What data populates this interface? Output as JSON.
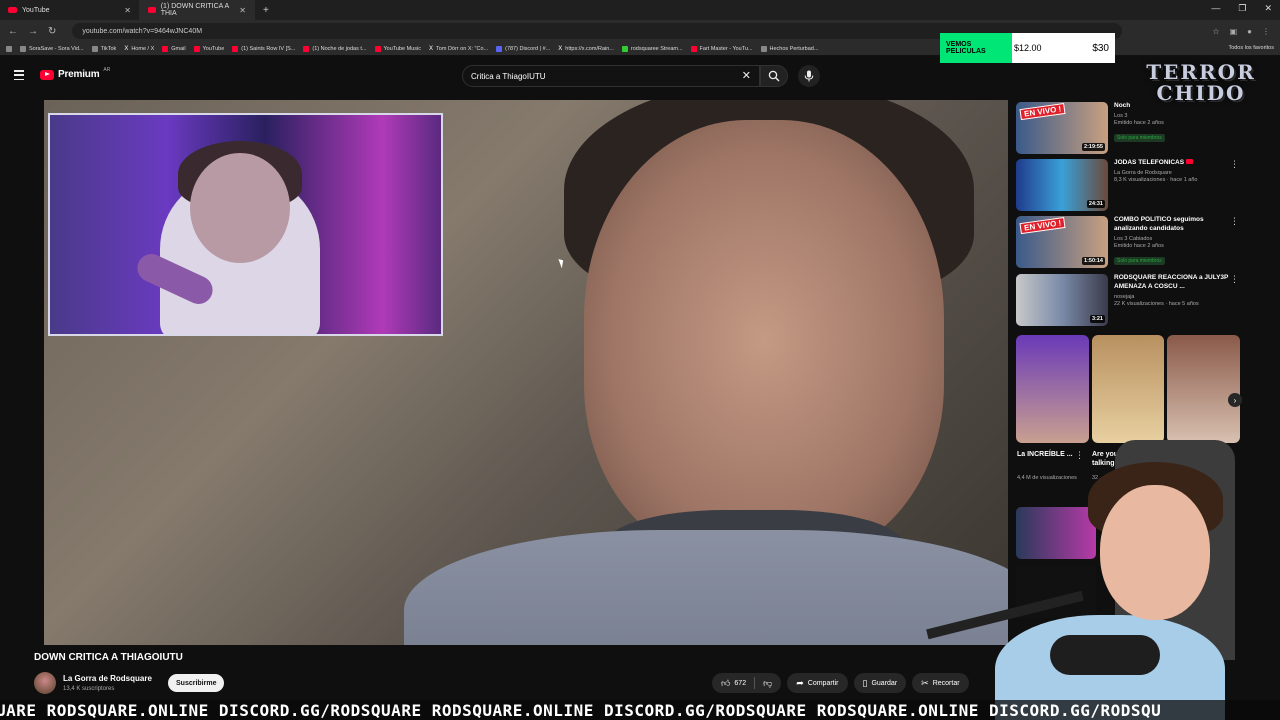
{
  "browser": {
    "tabs": [
      {
        "label": "YouTube"
      },
      {
        "label": "(1) DOWN CRITICA A THIA"
      }
    ],
    "url": "youtube.com/watch?v=9464wJNC40M",
    "bookmarks": [
      "SoraSave - Sora Vid...",
      "TikTok",
      "Home / X",
      "Gmail",
      "YouTube",
      "(1) Saints Row IV [S...",
      "(1) Noche de jodas t...",
      "YouTube Music",
      "Tom Dörr on X: \"Co...",
      "(787) Discord | #...",
      "https://x.com/Rain...",
      "rodsquaree Stream...",
      "Fart Master - YouTu...",
      "Hechos Perturbad..."
    ],
    "bookmarks_right": "Todos los favoritos"
  },
  "masthead": {
    "logo": "Premium",
    "region": "AR",
    "search_value": "Critica a ThiagoIUTU"
  },
  "video": {
    "title": "DOWN CRITICA A THIAGOIUTU",
    "channel": "La Gorra de Rodsquare",
    "subscribers": "13,4 K suscriptores",
    "subscribe_label": "Suscribirme",
    "likes": "672",
    "share_label": "Compartir",
    "save_label": "Guardar",
    "clip_label": "Recortar"
  },
  "rail": {
    "items": [
      {
        "title": "Noch",
        "channel": "Los 3",
        "views": "Emitido hace 2 años",
        "member": "Solo para miembros",
        "duration": "2:19:55",
        "live": "EN VIVO !"
      },
      {
        "title": "JODAS TELEFONICAS",
        "channel": "La Gorra de Rodsquare",
        "views": "8,3 K visualizaciones · hace 1 año",
        "member": "",
        "duration": "24:31",
        "live": ""
      },
      {
        "title": "COMBO POLITICO seguimos analizando candidatos",
        "channel": "Los 3 Cabiados",
        "views": "Emitido hace 2 años",
        "member": "Solo para miembros",
        "duration": "1:50:14",
        "live": "EN VIVO !"
      },
      {
        "title": "RODSQUARE REACCIONA a JULY3P AMENAZA A COSCU ...",
        "channel": "nosejaja",
        "views": "22 K visualizaciones · hace 5 años",
        "member": "",
        "duration": "3:21",
        "live": ""
      }
    ],
    "shorts": [
      {
        "title": "La INCREÍBLE ...",
        "views": "4,4 M de visualizaciones"
      },
      {
        "title": "Are you talking t",
        "views": "32"
      }
    ]
  },
  "overlay": {
    "promo_label": "VEMOS PELICULAS",
    "promo_price1": "$12.00",
    "promo_price2": "$30",
    "brand_line1": "TERROR",
    "brand_line2": "CHIDO",
    "ticker": "UARE RODSQUARE.ONLINE DISCORD.GG/RODSQUARE RODSQUARE.ONLINE DISCORD.GG/RODSQUARE RODSQUARE.ONLINE DISCORD.GG/RODSQU"
  },
  "colors": {
    "youtube_red": "#ff0033",
    "background": "#0f0f0f",
    "promo_green": "#00e676",
    "member_green": "#2ba640"
  }
}
